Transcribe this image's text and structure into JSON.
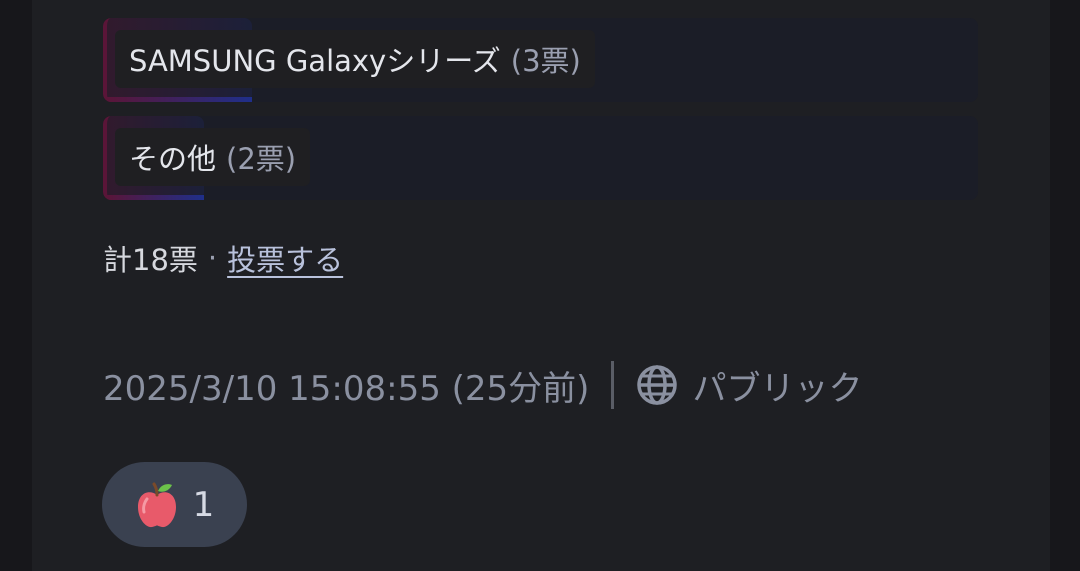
{
  "poll": {
    "options": [
      {
        "text": "SAMSUNG Galaxyシリーズ",
        "votes": "(3票)",
        "share": 0.167
      },
      {
        "text": "その他",
        "votes": "(2票)",
        "share": 0.111
      }
    ],
    "total": "計18票",
    "separator": "·",
    "vote_link": "投票する"
  },
  "meta": {
    "timestamp": "2025/3/10 15:08:55 (25分前)",
    "visibility": "パブリック",
    "visibility_icon": "globe-icon"
  },
  "reaction": {
    "emoji": "apple-icon",
    "count": "1"
  },
  "colors": {
    "background": "#1e1f23",
    "option_bg": "#1b1d27",
    "bar_start": "#5a1538",
    "bar_end": "#1f2f8a",
    "link": "#b9c2dc",
    "muted_text": "#8a90a0",
    "reaction_bg": "#3a4150"
  }
}
